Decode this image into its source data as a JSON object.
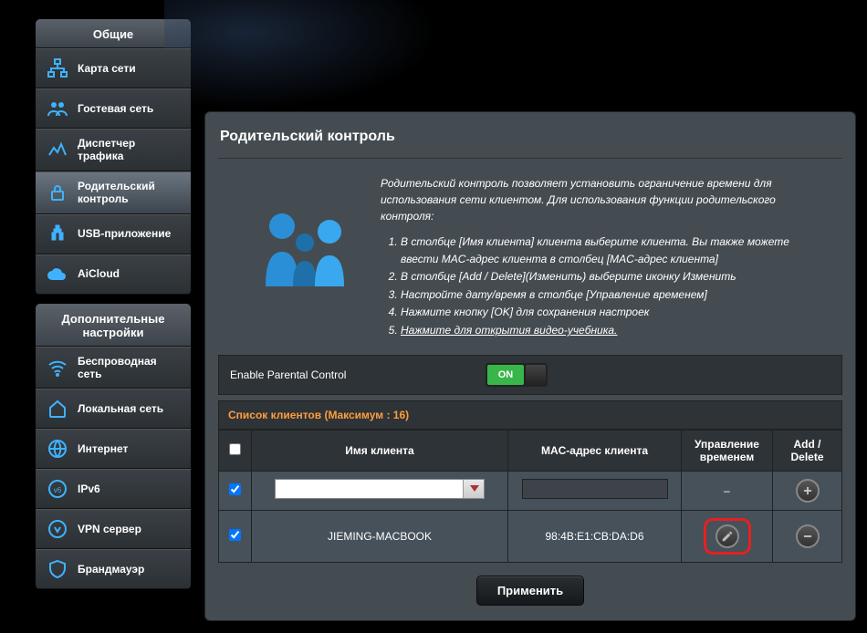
{
  "sidebar": {
    "general": {
      "header": "Общие",
      "items": [
        {
          "label": "Карта сети",
          "icon": "network-map"
        },
        {
          "label": "Гостевая сеть",
          "icon": "guest"
        },
        {
          "label": "Диспетчер трафика",
          "icon": "traffic"
        },
        {
          "label": "Родительский контроль",
          "icon": "parental"
        },
        {
          "label": "USB-приложение",
          "icon": "usb"
        },
        {
          "label": "AiCloud",
          "icon": "cloud"
        }
      ]
    },
    "advanced": {
      "header": "Дополнительные настройки",
      "items": [
        {
          "label": "Беспроводная сеть",
          "icon": "wifi"
        },
        {
          "label": "Локальная сеть",
          "icon": "lan"
        },
        {
          "label": "Интернет",
          "icon": "globe"
        },
        {
          "label": "IPv6",
          "icon": "ipv6"
        },
        {
          "label": "VPN сервер",
          "icon": "vpn"
        },
        {
          "label": "Брандмауэр",
          "icon": "firewall"
        }
      ]
    }
  },
  "page": {
    "title": "Родительский контроль",
    "description": "Родительский контроль позволяет установить ограничение времени для использования сети клиентом. Для использования функции родительского контроля:",
    "steps": [
      "В столбце [Имя клиента] клиента выберите клиента. Вы также можете ввести MAC-адрес клиента в столбец [MAC-адрес клиента]",
      "В столбце [Add / Delete](Изменить) выберите иконку Изменить",
      "Настройте дату/время в столбце [Управление временем]",
      "Нажмите кнопку [OK] для сохранения настроек",
      "Нажмите для открытия видео-учебника."
    ],
    "enable_label": "Enable Parental Control",
    "toggle_on": "ON",
    "clients_title": "Список клиентов (Maксимум : 16)",
    "columns": {
      "name": "Имя клиента",
      "mac": "MAC-адрес клиента",
      "time": "Управление временем",
      "action": "Add / Delete"
    },
    "rows": [
      {
        "checked": true,
        "name": "",
        "mac": "",
        "time": "–",
        "action": "add"
      },
      {
        "checked": true,
        "name": "JIEMING-MACBOOK",
        "mac": "98:4B:E1:CB:DA:D6",
        "time": "edit",
        "action": "delete"
      }
    ],
    "apply": "Применить"
  }
}
